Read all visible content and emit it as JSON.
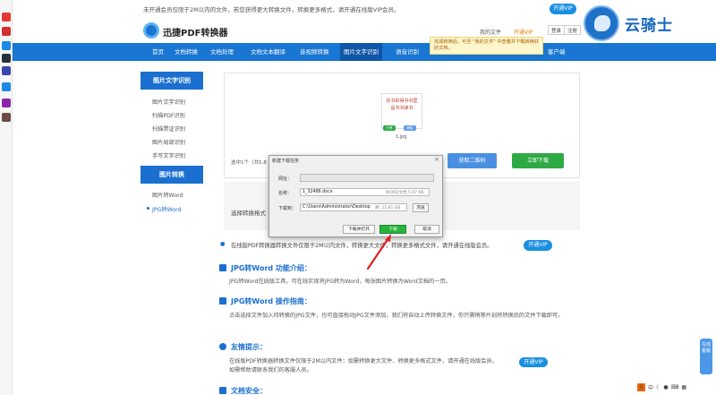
{
  "notice": {
    "text": "未开通会员仅限于2M以内的文件，若您获得更大转换文件，转换更多格式，请开通在线版VIP会员。",
    "vip_label": "开通VIP"
  },
  "header": {
    "logo": "迅捷PDF转换器",
    "my_files": "我的文件",
    "vip_link": "开通VIP",
    "login": "登录",
    "register": "注册"
  },
  "watermark": {
    "text": "云骑士"
  },
  "tooltip": "完成转换后，可至 \"我的文件\" 中查看并下载转换好的文档。",
  "nav": {
    "items": [
      "首页",
      "文档转换",
      "文档处理",
      "文档文本翻译",
      "音视频转换",
      "图片文字识别",
      "语音识别",
      "客户端"
    ]
  },
  "sidebar": {
    "sections": [
      {
        "title": "图片文字识别",
        "items": [
          "图片文字识别",
          "扫描PDF识别",
          "扫描票证识别",
          "图片局部识别",
          "手写文字识别"
        ]
      },
      {
        "title": "图片转换",
        "items": [
          "图片转Word",
          "JPG转Word"
        ]
      }
    ],
    "active": "JPG转Word"
  },
  "upload": {
    "thumb_lines": [
      "好书的得书书里",
      "是书书读书"
    ],
    "chip_share": "分享",
    "chip_delete": "删除",
    "file_name": "1.jpg",
    "selected_info": "选中1个（共5.8",
    "qr_button": "获取二维码",
    "download_button": "立即下载"
  },
  "format": {
    "label": "选择转换格式"
  },
  "info_bar": {
    "text": "在线版PDF转换器转换文件仅限于2M以内文件，转换更大文件，转换更多格式文件，请开通在线版会员。",
    "vip_label": "开通VIP"
  },
  "sections": {
    "intro_title": "JPG转Word 功能介绍：",
    "intro_text": "JPG转Word在线版工具，可在线实现将JPG转为Word，每张图片转换为Word文档的一页。",
    "guide_title": "JPG转Word 操作指南：",
    "guide_text": "点击选择文件加入待转换的JPG文件，也可直接拖动JPG文件添加，我们将自动上传转换文件，你只需稍等片刻将转换后的文件下载即可。",
    "tips_title": "友情提示：",
    "tips_text": "在线版PDF转换器转换文件仅限于2M以内文件；如需转换更大文件、转换更多格式文件，请开通在线版会员。",
    "tips_vip": "开通VIP",
    "tips_help": "如需帮助请联系我们的客服人员。",
    "security_title": "文档安全："
  },
  "dialog": {
    "title": "新建下载任务",
    "url_label": "网址：",
    "name_label": "名称：",
    "name_value": "1_32486.docx",
    "name_sub": "WORD文档 5.97 KB",
    "path_label": "下载到：",
    "path_value": "C:\\Users\\Administrator\\Desktop",
    "path_sub": "剩: 15.81 GB",
    "browse": "浏览",
    "open_button": "下载并打开",
    "download_button": "下载",
    "cancel_button": "取消"
  },
  "float_tab": "在线客服",
  "tray": {
    "ime": "S",
    "lang": "中"
  },
  "colors": {
    "brand": "#1976d2",
    "green": "#26b43e",
    "red_arrow": "#e02020"
  }
}
